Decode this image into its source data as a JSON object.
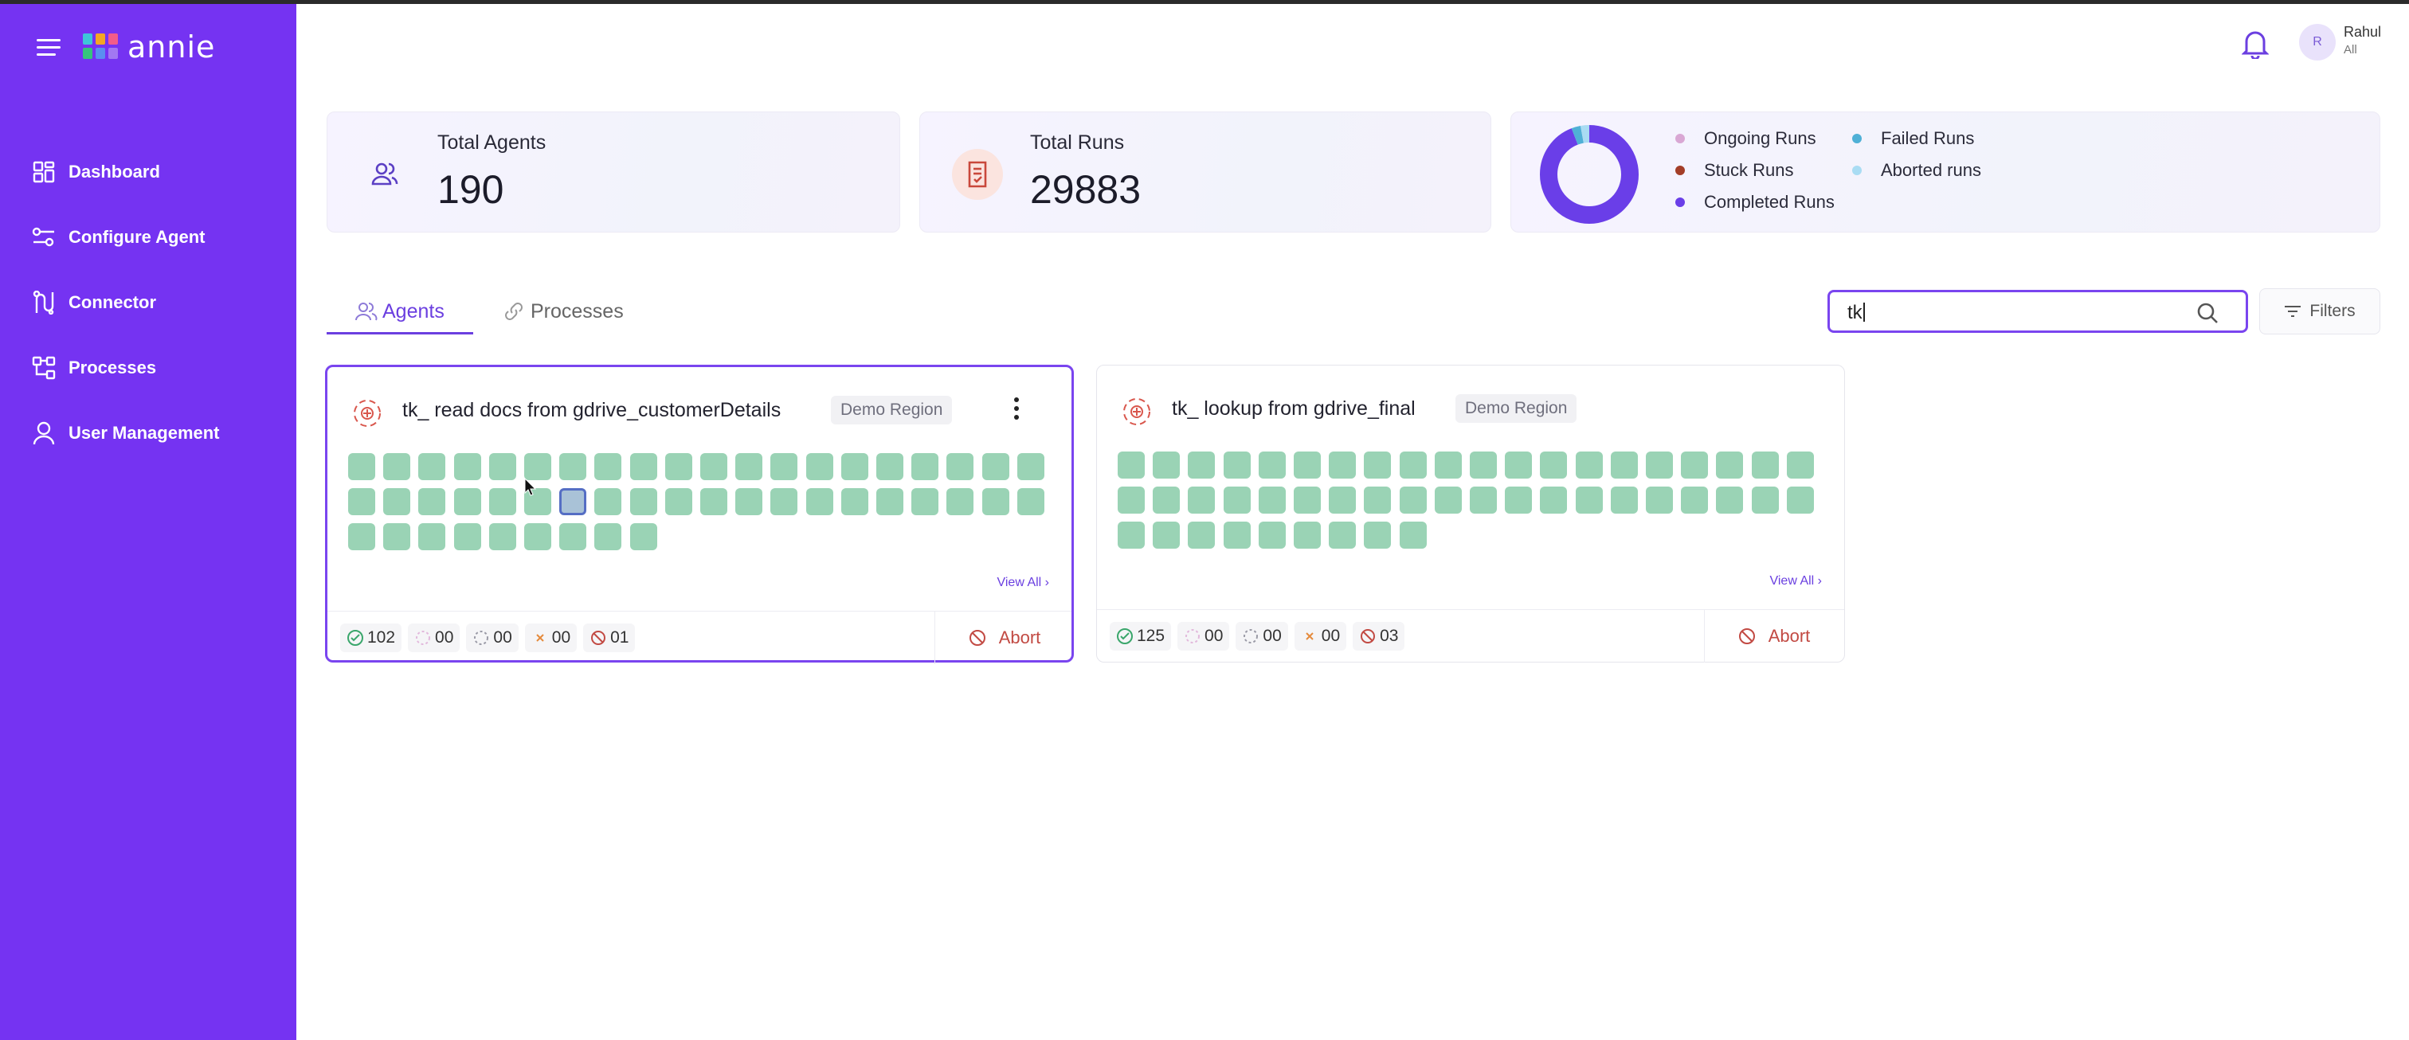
{
  "app": {
    "logo_text": "annie",
    "logo_colors": [
      "#3ec6d9",
      "#f5a623",
      "#f25c8a",
      "#36c47c",
      "#5b8ef0",
      "#a278f2"
    ]
  },
  "sidebar": {
    "background": "#7533f2",
    "items": [
      {
        "label": "Dashboard",
        "icon": "dashboard-icon"
      },
      {
        "label": "Configure Agent",
        "icon": "configure-icon"
      },
      {
        "label": "Connector",
        "icon": "connector-icon"
      },
      {
        "label": "Processes",
        "icon": "processes-icon"
      },
      {
        "label": "User Management",
        "icon": "user-icon"
      }
    ]
  },
  "header": {
    "user_initial": "R",
    "user_name": "Rahul",
    "user_role": "All"
  },
  "stats": {
    "total_agents_label": "Total Agents",
    "total_agents_value": "190",
    "total_runs_label": "Total Runs",
    "total_runs_value": "29883",
    "legend": [
      {
        "label": "Ongoing Runs",
        "color": "#d9a7d4"
      },
      {
        "label": "Failed Runs",
        "color": "#4fb0d6"
      },
      {
        "label": "Stuck Runs",
        "color": "#a33d28"
      },
      {
        "label": "Aborted runs",
        "color": "#a9dcf3"
      },
      {
        "label": "Completed Runs",
        "color": "#6a3ee8"
      }
    ],
    "donut_fractions": {
      "completed": 0.94,
      "failed": 0.03,
      "aborted": 0.03
    }
  },
  "tabs": [
    {
      "label": "Agents",
      "active": true
    },
    {
      "label": "Processes",
      "active": false
    }
  ],
  "search": {
    "value": "tk"
  },
  "filters_label": "Filters",
  "agents": [
    {
      "title": "tk_ read docs from gdrive_customerDetails",
      "region": "Demo Region",
      "run_count": 49,
      "active_run_index": 26,
      "view_all": "View All",
      "completed": "102",
      "ongoing": "00",
      "stuck": "00",
      "failed": "00",
      "aborted": "01",
      "abort_label": "Abort"
    },
    {
      "title": "tk_ lookup from gdrive_final",
      "region": "Demo Region",
      "run_count": 49,
      "active_run_index": -1,
      "view_all": "View All",
      "completed": "125",
      "ongoing": "00",
      "stuck": "00",
      "failed": "00",
      "aborted": "03",
      "abort_label": "Abort"
    }
  ]
}
